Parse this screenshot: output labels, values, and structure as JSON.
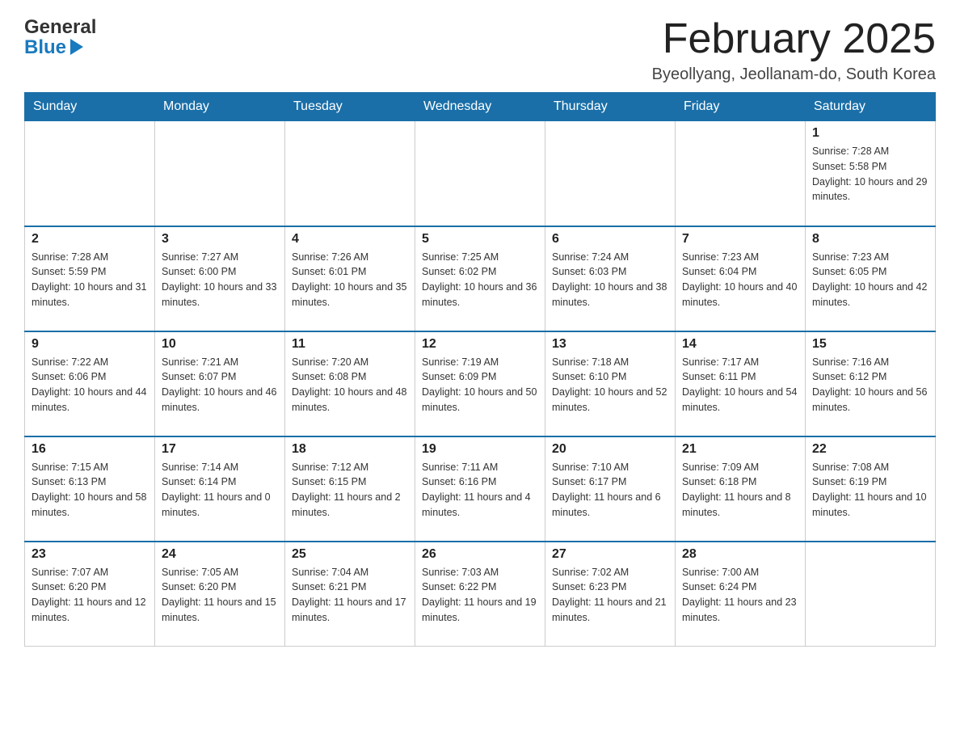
{
  "header": {
    "logo_general": "General",
    "logo_blue": "Blue",
    "month_title": "February 2025",
    "location": "Byeollyang, Jeollanam-do, South Korea"
  },
  "days_of_week": [
    "Sunday",
    "Monday",
    "Tuesday",
    "Wednesday",
    "Thursday",
    "Friday",
    "Saturday"
  ],
  "weeks": [
    {
      "days": [
        {
          "number": "",
          "sunrise": "",
          "sunset": "",
          "daylight": "",
          "empty": true
        },
        {
          "number": "",
          "sunrise": "",
          "sunset": "",
          "daylight": "",
          "empty": true
        },
        {
          "number": "",
          "sunrise": "",
          "sunset": "",
          "daylight": "",
          "empty": true
        },
        {
          "number": "",
          "sunrise": "",
          "sunset": "",
          "daylight": "",
          "empty": true
        },
        {
          "number": "",
          "sunrise": "",
          "sunset": "",
          "daylight": "",
          "empty": true
        },
        {
          "number": "",
          "sunrise": "",
          "sunset": "",
          "daylight": "",
          "empty": true
        },
        {
          "number": "1",
          "sunrise": "Sunrise: 7:28 AM",
          "sunset": "Sunset: 5:58 PM",
          "daylight": "Daylight: 10 hours and 29 minutes.",
          "empty": false
        }
      ]
    },
    {
      "days": [
        {
          "number": "2",
          "sunrise": "Sunrise: 7:28 AM",
          "sunset": "Sunset: 5:59 PM",
          "daylight": "Daylight: 10 hours and 31 minutes.",
          "empty": false
        },
        {
          "number": "3",
          "sunrise": "Sunrise: 7:27 AM",
          "sunset": "Sunset: 6:00 PM",
          "daylight": "Daylight: 10 hours and 33 minutes.",
          "empty": false
        },
        {
          "number": "4",
          "sunrise": "Sunrise: 7:26 AM",
          "sunset": "Sunset: 6:01 PM",
          "daylight": "Daylight: 10 hours and 35 minutes.",
          "empty": false
        },
        {
          "number": "5",
          "sunrise": "Sunrise: 7:25 AM",
          "sunset": "Sunset: 6:02 PM",
          "daylight": "Daylight: 10 hours and 36 minutes.",
          "empty": false
        },
        {
          "number": "6",
          "sunrise": "Sunrise: 7:24 AM",
          "sunset": "Sunset: 6:03 PM",
          "daylight": "Daylight: 10 hours and 38 minutes.",
          "empty": false
        },
        {
          "number": "7",
          "sunrise": "Sunrise: 7:23 AM",
          "sunset": "Sunset: 6:04 PM",
          "daylight": "Daylight: 10 hours and 40 minutes.",
          "empty": false
        },
        {
          "number": "8",
          "sunrise": "Sunrise: 7:23 AM",
          "sunset": "Sunset: 6:05 PM",
          "daylight": "Daylight: 10 hours and 42 minutes.",
          "empty": false
        }
      ]
    },
    {
      "days": [
        {
          "number": "9",
          "sunrise": "Sunrise: 7:22 AM",
          "sunset": "Sunset: 6:06 PM",
          "daylight": "Daylight: 10 hours and 44 minutes.",
          "empty": false
        },
        {
          "number": "10",
          "sunrise": "Sunrise: 7:21 AM",
          "sunset": "Sunset: 6:07 PM",
          "daylight": "Daylight: 10 hours and 46 minutes.",
          "empty": false
        },
        {
          "number": "11",
          "sunrise": "Sunrise: 7:20 AM",
          "sunset": "Sunset: 6:08 PM",
          "daylight": "Daylight: 10 hours and 48 minutes.",
          "empty": false
        },
        {
          "number": "12",
          "sunrise": "Sunrise: 7:19 AM",
          "sunset": "Sunset: 6:09 PM",
          "daylight": "Daylight: 10 hours and 50 minutes.",
          "empty": false
        },
        {
          "number": "13",
          "sunrise": "Sunrise: 7:18 AM",
          "sunset": "Sunset: 6:10 PM",
          "daylight": "Daylight: 10 hours and 52 minutes.",
          "empty": false
        },
        {
          "number": "14",
          "sunrise": "Sunrise: 7:17 AM",
          "sunset": "Sunset: 6:11 PM",
          "daylight": "Daylight: 10 hours and 54 minutes.",
          "empty": false
        },
        {
          "number": "15",
          "sunrise": "Sunrise: 7:16 AM",
          "sunset": "Sunset: 6:12 PM",
          "daylight": "Daylight: 10 hours and 56 minutes.",
          "empty": false
        }
      ]
    },
    {
      "days": [
        {
          "number": "16",
          "sunrise": "Sunrise: 7:15 AM",
          "sunset": "Sunset: 6:13 PM",
          "daylight": "Daylight: 10 hours and 58 minutes.",
          "empty": false
        },
        {
          "number": "17",
          "sunrise": "Sunrise: 7:14 AM",
          "sunset": "Sunset: 6:14 PM",
          "daylight": "Daylight: 11 hours and 0 minutes.",
          "empty": false
        },
        {
          "number": "18",
          "sunrise": "Sunrise: 7:12 AM",
          "sunset": "Sunset: 6:15 PM",
          "daylight": "Daylight: 11 hours and 2 minutes.",
          "empty": false
        },
        {
          "number": "19",
          "sunrise": "Sunrise: 7:11 AM",
          "sunset": "Sunset: 6:16 PM",
          "daylight": "Daylight: 11 hours and 4 minutes.",
          "empty": false
        },
        {
          "number": "20",
          "sunrise": "Sunrise: 7:10 AM",
          "sunset": "Sunset: 6:17 PM",
          "daylight": "Daylight: 11 hours and 6 minutes.",
          "empty": false
        },
        {
          "number": "21",
          "sunrise": "Sunrise: 7:09 AM",
          "sunset": "Sunset: 6:18 PM",
          "daylight": "Daylight: 11 hours and 8 minutes.",
          "empty": false
        },
        {
          "number": "22",
          "sunrise": "Sunrise: 7:08 AM",
          "sunset": "Sunset: 6:19 PM",
          "daylight": "Daylight: 11 hours and 10 minutes.",
          "empty": false
        }
      ]
    },
    {
      "days": [
        {
          "number": "23",
          "sunrise": "Sunrise: 7:07 AM",
          "sunset": "Sunset: 6:20 PM",
          "daylight": "Daylight: 11 hours and 12 minutes.",
          "empty": false
        },
        {
          "number": "24",
          "sunrise": "Sunrise: 7:05 AM",
          "sunset": "Sunset: 6:20 PM",
          "daylight": "Daylight: 11 hours and 15 minutes.",
          "empty": false
        },
        {
          "number": "25",
          "sunrise": "Sunrise: 7:04 AM",
          "sunset": "Sunset: 6:21 PM",
          "daylight": "Daylight: 11 hours and 17 minutes.",
          "empty": false
        },
        {
          "number": "26",
          "sunrise": "Sunrise: 7:03 AM",
          "sunset": "Sunset: 6:22 PM",
          "daylight": "Daylight: 11 hours and 19 minutes.",
          "empty": false
        },
        {
          "number": "27",
          "sunrise": "Sunrise: 7:02 AM",
          "sunset": "Sunset: 6:23 PM",
          "daylight": "Daylight: 11 hours and 21 minutes.",
          "empty": false
        },
        {
          "number": "28",
          "sunrise": "Sunrise: 7:00 AM",
          "sunset": "Sunset: 6:24 PM",
          "daylight": "Daylight: 11 hours and 23 minutes.",
          "empty": false
        },
        {
          "number": "",
          "sunrise": "",
          "sunset": "",
          "daylight": "",
          "empty": true
        }
      ]
    }
  ]
}
